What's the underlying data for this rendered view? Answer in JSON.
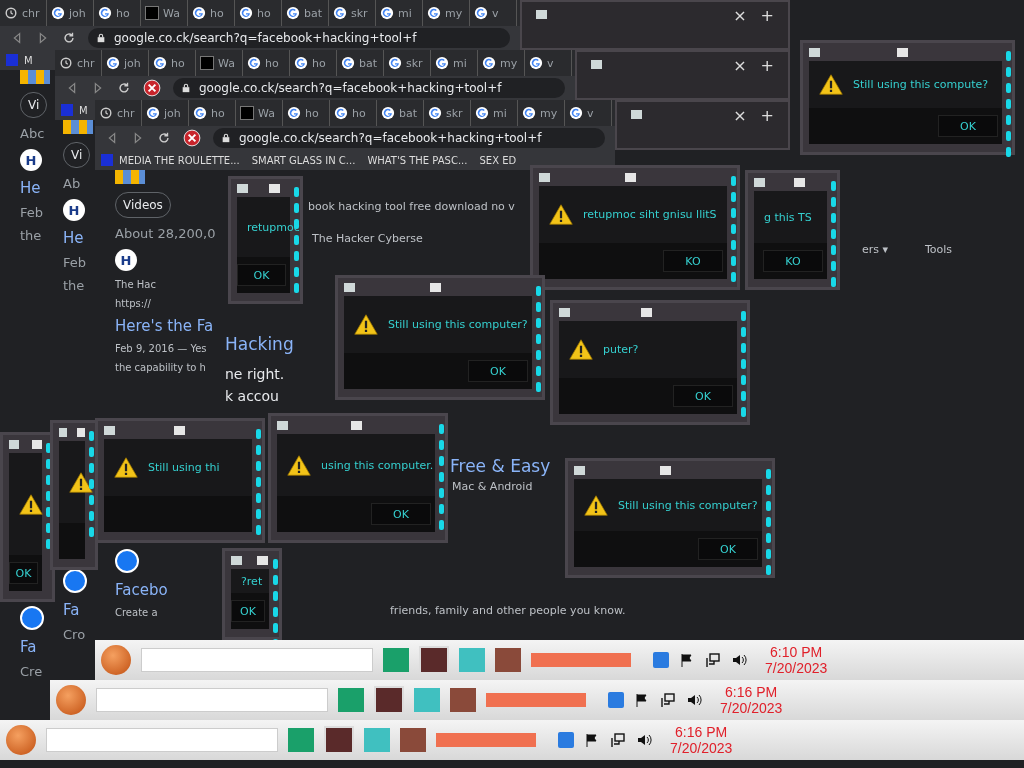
{
  "browsers": [
    {
      "tabs": [
        "chr",
        "joh",
        "ho",
        "Wa",
        "ho",
        "ho",
        "bat",
        "skr",
        "mi",
        "my",
        "v"
      ],
      "address": "google.co.ck/search?q=facebook+hacking+tool+f",
      "bookmark": "M"
    },
    {
      "tabs": [
        "chr",
        "joh",
        "ho",
        "Wa",
        "ho",
        "ho",
        "bat",
        "skr",
        "mi",
        "my",
        "v"
      ],
      "address": "google.co.ck/search?q=facebook+hacking+tool+f",
      "bookmark": "M"
    },
    {
      "tabs": [
        "chr",
        "joh",
        "ho",
        "Wa",
        "ho",
        "ho",
        "bat",
        "skr",
        "mi",
        "my",
        "v"
      ],
      "address": "google.co.ck/search?q=facebook+hacking+tool+f",
      "bookmark": "MEDIA THE ROULETTE..."
    }
  ],
  "bookmarks": [
    "SMART GLASS IN C...",
    "WHAT'S THE PASC...",
    "SEX ED"
  ],
  "columns": [
    {
      "items": [
        {
          "kind": "chip",
          "text": "Vi"
        },
        {
          "kind": "text",
          "text": "Abc"
        },
        {
          "kind": "logo-h",
          "text": "H"
        },
        {
          "kind": "link",
          "text": "He"
        },
        {
          "kind": "text",
          "text": "Feb"
        },
        {
          "kind": "text",
          "text": "the"
        },
        {
          "kind": "gap"
        },
        {
          "kind": "logo-f"
        },
        {
          "kind": "link",
          "text": "Fa"
        },
        {
          "kind": "text",
          "text": "Cre"
        }
      ]
    },
    {
      "items": [
        {
          "kind": "chip",
          "text": "Vi"
        },
        {
          "kind": "text",
          "text": "Ab"
        },
        {
          "kind": "logo-h",
          "text": "H"
        },
        {
          "kind": "link",
          "text": "He"
        },
        {
          "kind": "text",
          "text": "Feb"
        },
        {
          "kind": "text",
          "text": "the"
        },
        {
          "kind": "gap"
        },
        {
          "kind": "logo-f"
        },
        {
          "kind": "link",
          "text": "Fa"
        },
        {
          "kind": "text",
          "text": "Cro"
        }
      ]
    },
    {
      "items": [
        {
          "kind": "chip",
          "text": "Videos"
        },
        {
          "kind": "text",
          "text": "About 28,200,0"
        },
        {
          "kind": "logo-h",
          "text": "H"
        },
        {
          "kind": "small",
          "text": "The Hac"
        },
        {
          "kind": "small",
          "text": "https://"
        },
        {
          "kind": "link",
          "text": "Here's the Fa"
        },
        {
          "kind": "small",
          "text": "Feb 9, 2016 — Yes"
        },
        {
          "kind": "small",
          "text": "the capability to h"
        },
        {
          "kind": "gap"
        },
        {
          "kind": "logo-f"
        },
        {
          "kind": "link",
          "text": "Facebo"
        },
        {
          "kind": "small",
          "text": "Create a"
        }
      ]
    }
  ],
  "fragments": [
    {
      "kind": "snippet",
      "text": "book hacking tool free download no v"
    },
    {
      "kind": "link",
      "text": "Hacking"
    },
    {
      "kind": "body",
      "text": "ne right."
    },
    {
      "kind": "body",
      "text": "k accou"
    },
    {
      "kind": "link",
      "text": "Free & Easy"
    },
    {
      "kind": "snippet",
      "text": "Mac & Android"
    },
    {
      "kind": "snippet",
      "text": "friends, family and other people you know."
    },
    {
      "kind": "snippet",
      "text": "ers ▾"
    },
    {
      "kind": "snippet",
      "text": "Tools"
    },
    {
      "kind": "snippet",
      "text": "The Hacker Cyberse"
    }
  ],
  "stack_controls": [
    {
      "close": "×",
      "new_tab": "+"
    },
    {
      "close": "×",
      "new_tab": "+"
    },
    {
      "close": "×",
      "new_tab": "+"
    }
  ],
  "dialogs": [
    {
      "kind": "warning",
      "message": "Still using this compute?",
      "button": "OK"
    },
    {
      "kind": "warning",
      "message": "retupmoc",
      "button": "OK"
    },
    {
      "kind": "warning",
      "message": "retupmoc siht gnisu llitS",
      "button": "KO"
    },
    {
      "kind": "warning",
      "message": "g this TS",
      "button": "KO"
    },
    {
      "kind": "warning",
      "message": "Still using this computer?",
      "button": "OK"
    },
    {
      "kind": "warning",
      "message": "puter?",
      "button": "OK"
    },
    {
      "kind": "warning",
      "button": "OK"
    },
    {
      "kind": "warning"
    },
    {
      "kind": "warning",
      "message": "Still using thi"
    },
    {
      "kind": "warning",
      "message": "using this computer.",
      "button": "OK"
    },
    {
      "kind": "warning",
      "message": "Still using this computer?",
      "button": "OK"
    },
    {
      "kind": "warning",
      "message": "?ret",
      "button": "OK"
    }
  ],
  "taskbars": [
    {
      "time": "6:10 PM",
      "date": "7/20/2023"
    },
    {
      "time": "6:16 PM",
      "date": "7/20/2023"
    },
    {
      "time": "6:16 PM",
      "date": "7/20/2023"
    }
  ]
}
